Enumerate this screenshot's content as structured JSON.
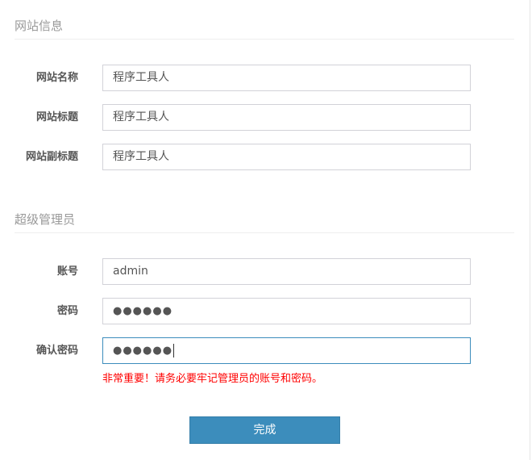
{
  "site_info": {
    "title": "网站信息",
    "fields": [
      {
        "label": "网站名称",
        "value": "程序工具人"
      },
      {
        "label": "网站标题",
        "value": "程序工具人"
      },
      {
        "label": "网站副标题",
        "value": "程序工具人"
      }
    ]
  },
  "admin": {
    "title": "超级管理员",
    "account_label": "账号",
    "account_value": "admin",
    "password_label": "密码",
    "password_value": "●●●●●●",
    "confirm_label": "确认密码",
    "confirm_value": "●●●●●●",
    "warning": "非常重要！请务必要牢记管理员的账号和密码。"
  },
  "submit_label": "完成"
}
